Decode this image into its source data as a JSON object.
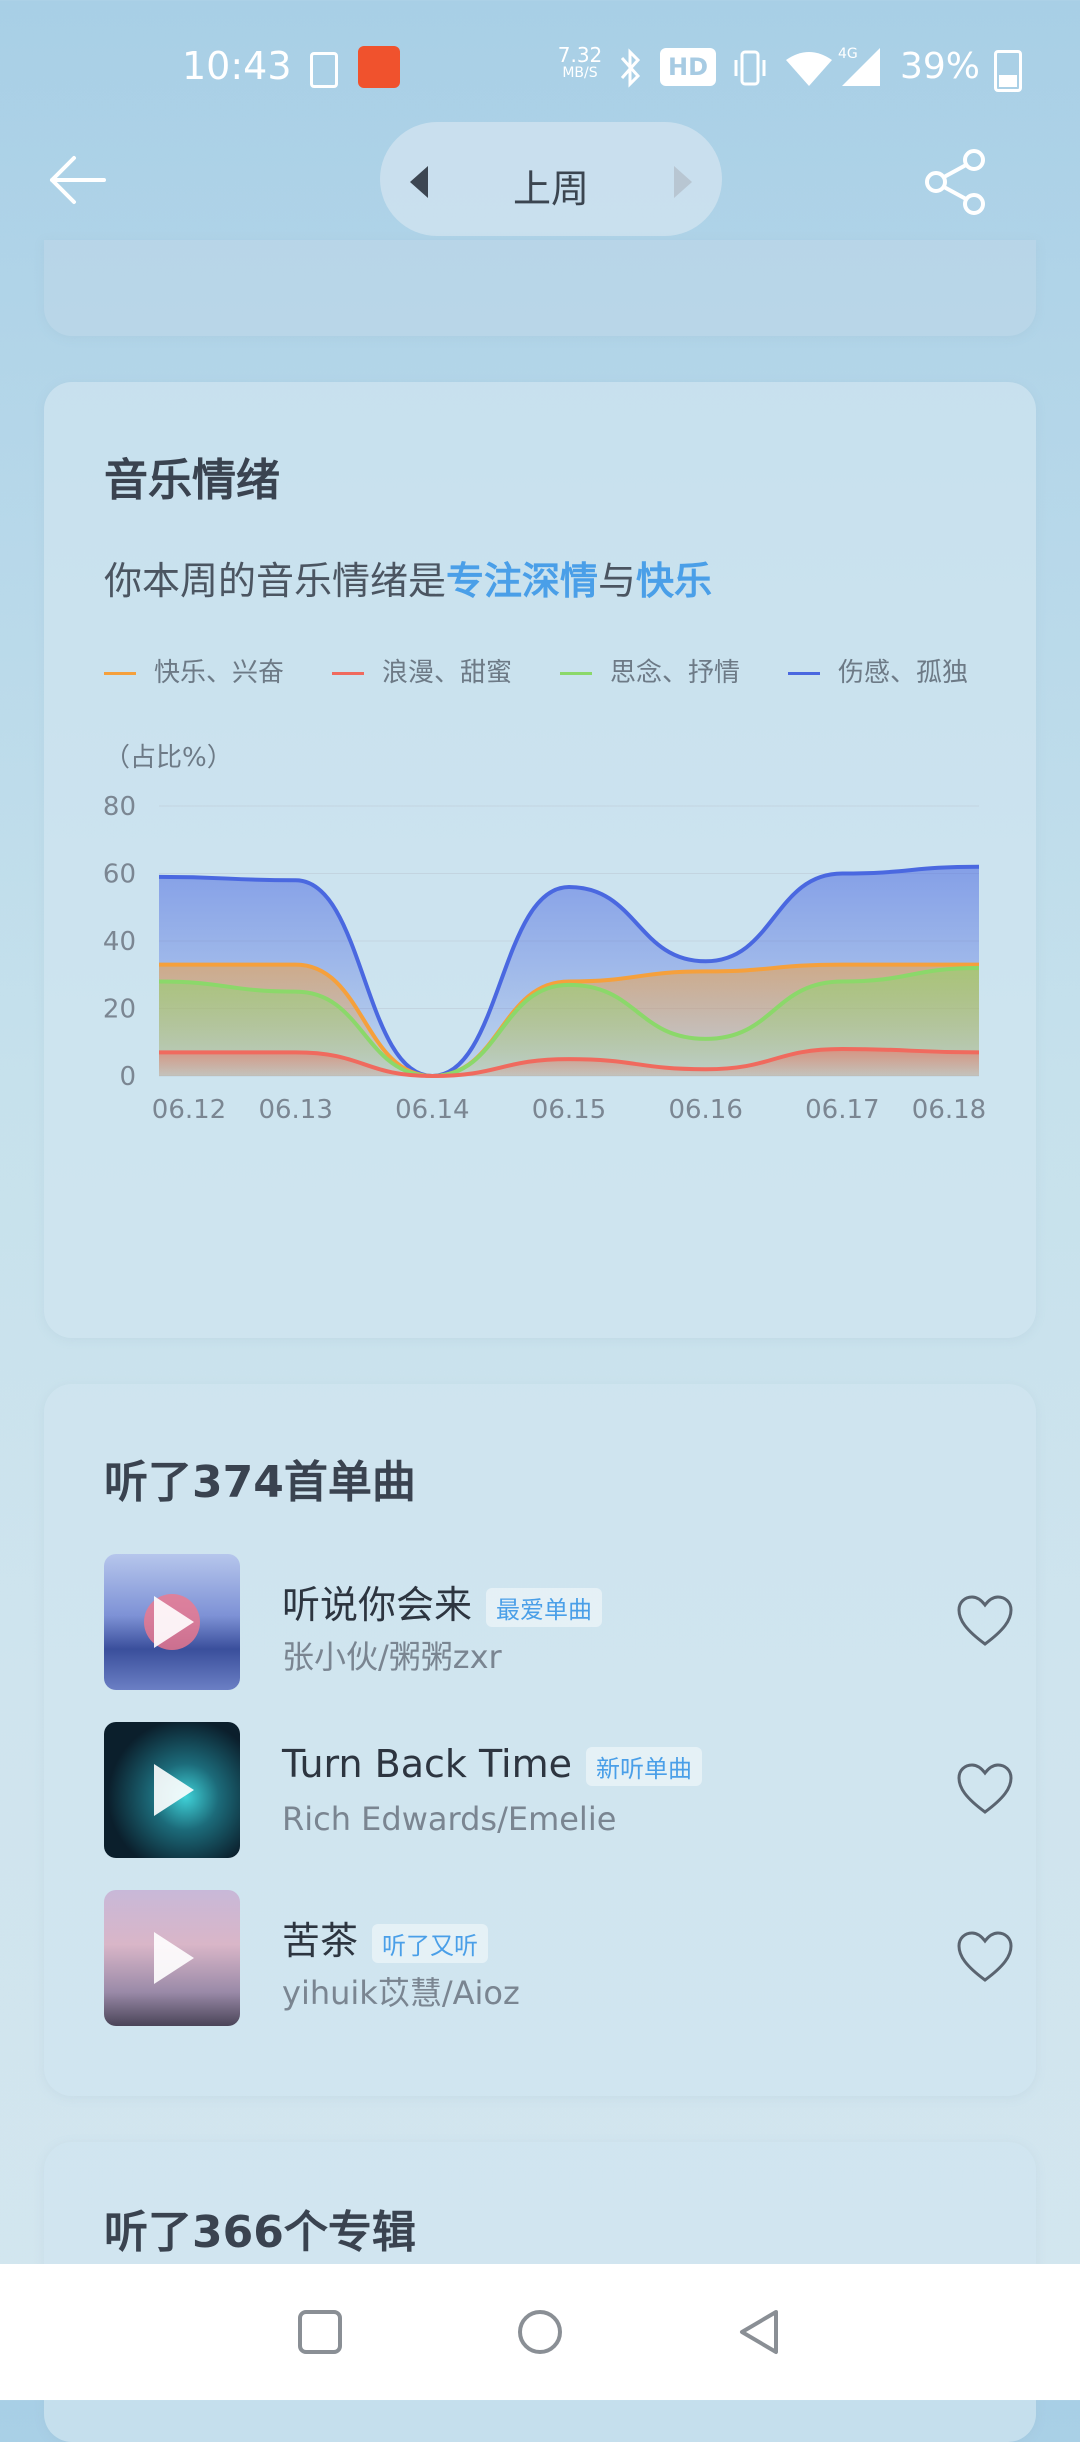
{
  "status_bar": {
    "time": "10:43",
    "network_speed_top": "7.32",
    "network_speed_bottom": "MB/S",
    "hd_label": "HD",
    "signal_label": "4G",
    "battery": "39%",
    "icons": [
      "download-icon",
      "app-icon",
      "bluetooth-icon",
      "vibrate-icon",
      "wifi-icon",
      "signal-icon",
      "battery-icon"
    ]
  },
  "header": {
    "period_label": "上周"
  },
  "emotion": {
    "title": "音乐情绪",
    "subtitle_prefix": "你本周的音乐情绪是",
    "highlight1": "专注深情",
    "connector": "与",
    "highlight2": "快乐",
    "legend": [
      {
        "label": "快乐、兴奋",
        "color": "#f5a03c"
      },
      {
        "label": "浪漫、甜蜜",
        "color": "#f06a5e"
      },
      {
        "label": "思念、抒情",
        "color": "#8bd86a"
      },
      {
        "label": "伤感、孤独",
        "color": "#4a68e0"
      }
    ]
  },
  "chart_data": {
    "type": "area",
    "ylabel": "（占比%）",
    "ylim": [
      0,
      80
    ],
    "yticks": [
      "0",
      "20",
      "40",
      "60",
      "80"
    ],
    "categories": [
      "06.12",
      "06.13",
      "06.14",
      "06.15",
      "06.16",
      "06.17",
      "06.18"
    ],
    "series": [
      {
        "name": "伤感、孤独",
        "color": "#4a68e0",
        "values": [
          59,
          58,
          0,
          56,
          34,
          60,
          62
        ]
      },
      {
        "name": "快乐、兴奋",
        "color": "#f5a03c",
        "values": [
          33,
          33,
          0,
          28,
          31,
          33,
          33
        ]
      },
      {
        "name": "思念、抒情",
        "color": "#8bd86a",
        "values": [
          28,
          25,
          0,
          27,
          11,
          28,
          32
        ]
      },
      {
        "name": "浪漫、甜蜜",
        "color": "#f06a5e",
        "values": [
          7,
          7,
          0,
          5,
          2,
          8,
          7
        ]
      }
    ],
    "grid": true
  },
  "songs": {
    "title": "听了374首单曲",
    "items": [
      {
        "name": "听说你会来",
        "tag": "最爱单曲",
        "artist": "张小伙/粥粥zxr"
      },
      {
        "name": "Turn Back Time",
        "tag": "新听单曲",
        "artist": "Rich Edwards/Emelie"
      },
      {
        "name": "苦茶",
        "tag": "听了又听",
        "artist": "yihuik苡慧/Aioz"
      }
    ]
  },
  "albums": {
    "title": "听了366个专辑"
  }
}
